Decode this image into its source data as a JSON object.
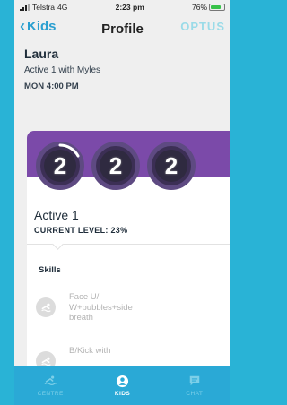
{
  "status_bar": {
    "carrier": "Telstra",
    "network": "4G",
    "time": "2:23 pm",
    "battery": "76%"
  },
  "nav": {
    "back_label": "Kids",
    "title": "Profile",
    "brand": "OPTUS"
  },
  "profile": {
    "name": "Laura",
    "class": "Active 1 with Myles",
    "schedule": "MON 4:00 PM"
  },
  "level_card": {
    "badges": [
      "2",
      "2",
      "2"
    ],
    "title": "Active 1",
    "progress_text": "CURRENT LEVEL: 23%",
    "progress_fraction": 0.23,
    "skills_heading": "Skills",
    "skills": [
      {
        "label": "Face U/ W+bubbles+side breath",
        "icon": "swim-icon"
      },
      {
        "label": "B/Kick with",
        "icon": "swim-icon"
      }
    ]
  },
  "tabbar": {
    "items": [
      {
        "label": "CENTRE",
        "icon": "swimmer-icon",
        "active": false
      },
      {
        "label": "KIDS",
        "icon": "user-icon",
        "active": true
      },
      {
        "label": "CHAT",
        "icon": "chat-icon",
        "active": false
      }
    ]
  },
  "colors": {
    "background": "#29b3d6",
    "accent_blue": "#2a9fd0",
    "banner_purple": "#7b4aa9",
    "tabbar": "#2aa9d6"
  }
}
